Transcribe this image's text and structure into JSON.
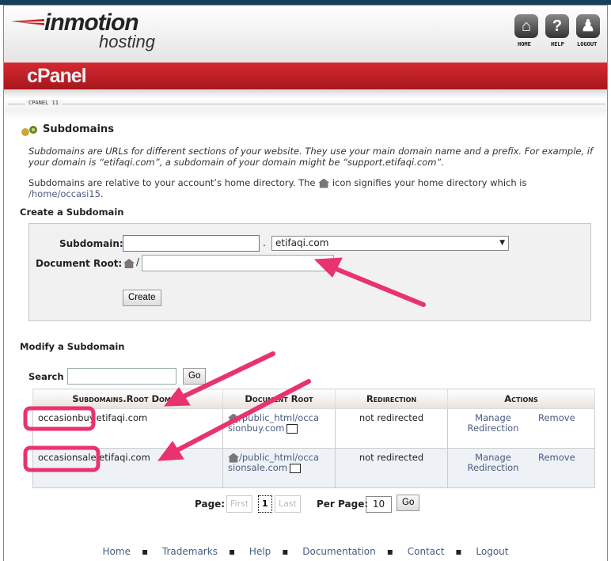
{
  "brand": {
    "logo_top": "inmotion",
    "logo_bottom": "hosting",
    "product": "cPanel",
    "version_label": "CPANEL 11"
  },
  "top_nav": [
    {
      "label": "HOME",
      "icon": "home-icon"
    },
    {
      "label": "HELP",
      "icon": "help-icon"
    },
    {
      "label": "LOGOUT",
      "icon": "user-icon"
    }
  ],
  "page": {
    "title": "Subdomains",
    "intro": "Subdomains are URLs for different sections of your website. They use your main domain name and a prefix. For example, if your domain is “etifaqi.com”, a subdomain of your domain might be “support.etifaqi.com”.",
    "home_note_pre": "Subdomains are relative to your account’s home directory. The",
    "home_note_post": "icon signifies your home directory which is",
    "home_dir": "/home/occasi15",
    "home_dir_suffix": "."
  },
  "create": {
    "heading": "Create a Subdomain",
    "subdomain_label": "Subdomain:",
    "subdomain_value": "",
    "dot": ".",
    "domain_selected": "etifaqi.com",
    "docroot_label": "Document Root:",
    "docroot_prefix": "/",
    "docroot_value": "",
    "button": "Create"
  },
  "modify": {
    "heading": "Modify a Subdomain",
    "search_label": "Search",
    "search_value": "",
    "go": "Go",
    "columns": [
      "Subdomains.Root Domain",
      "Document Root",
      "Redirection",
      "Actions"
    ],
    "rows": [
      {
        "domain": "occasionbuy.etifaqi.com",
        "docroot_a": "/public_html/occa",
        "docroot_b": "sionbuy.com",
        "redirection": "not redirected",
        "manage": "Manage Redirection",
        "remove": "Remove"
      },
      {
        "domain": "occasionsale.etifaqi.com",
        "docroot_a": "/public_html/occa",
        "docroot_b": "sionsale.com",
        "redirection": "not redirected",
        "manage": "Manage Redirection",
        "remove": "Remove"
      }
    ]
  },
  "pagination": {
    "page_label": "Page:",
    "first": "First",
    "current": "1",
    "last": "Last",
    "per_page_label": "Per Page:",
    "per_page_value": "10",
    "go": "Go"
  },
  "footer": [
    "Home",
    "Trademarks",
    "Help",
    "Documentation",
    "Contact",
    "Logout"
  ],
  "colors": {
    "accent_red": "#c0202a",
    "annotation": "#e8336f",
    "link": "#4a5c80"
  }
}
